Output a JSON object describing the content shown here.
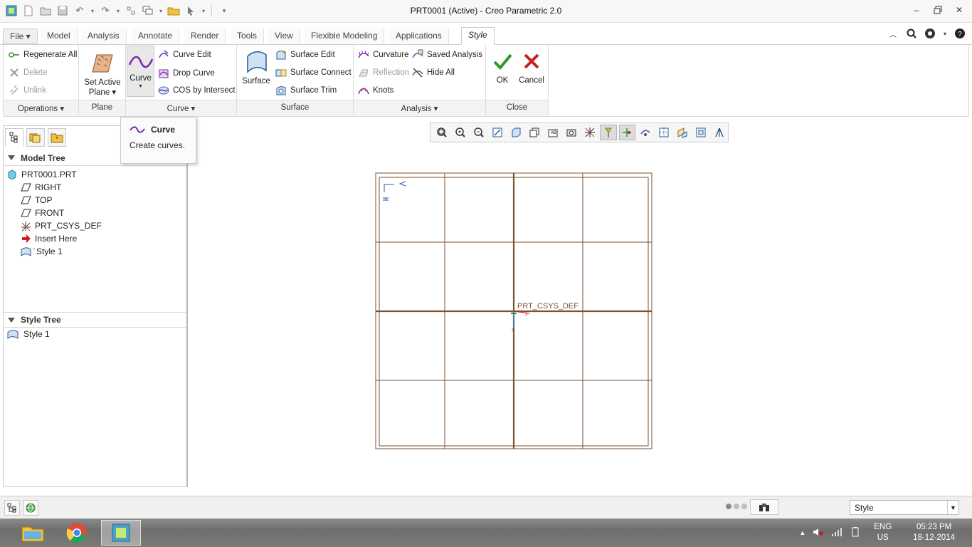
{
  "window": {
    "title": "PRT0001 (Active) - Creo Parametric 2.0"
  },
  "ribbon_tabs": [
    {
      "label": "File"
    },
    {
      "label": "Model"
    },
    {
      "label": "Analysis"
    },
    {
      "label": "Annotate"
    },
    {
      "label": "Render"
    },
    {
      "label": "Tools"
    },
    {
      "label": "View"
    },
    {
      "label": "Flexible Modeling"
    },
    {
      "label": "Applications"
    },
    {
      "label": "Style"
    }
  ],
  "operations": {
    "regenerate": "Regenerate All",
    "delete": "Delete",
    "unlink": "Unlink",
    "label": "Operations"
  },
  "plane": {
    "set_active_line1": "Set Active",
    "set_active_line2": "Plane",
    "label": "Plane"
  },
  "curve": {
    "curve_btn": "Curve",
    "curve_edit": "Curve Edit",
    "drop_curve": "Drop Curve",
    "cos_intersect": "COS by Intersect",
    "label": "Curve"
  },
  "surface": {
    "surface_btn": "Surface",
    "surface_edit": "Surface Edit",
    "surface_connect": "Surface Connect",
    "surface_trim": "Surface Trim",
    "label": "Surface"
  },
  "analysis": {
    "curvature": "Curvature",
    "reflection": "Reflection",
    "knots": "Knots",
    "saved_analysis": "Saved Analysis",
    "hide_all": "Hide All",
    "label": "Analysis"
  },
  "close": {
    "ok": "OK",
    "cancel": "Cancel",
    "label": "Close"
  },
  "tooltip": {
    "title": "Curve",
    "description": "Create curves."
  },
  "model_tree": {
    "header": "Model Tree",
    "root": "PRT0001.PRT",
    "items": [
      "RIGHT",
      "TOP",
      "FRONT",
      "PRT_CSYS_DEF",
      "Insert Here",
      "Style 1"
    ]
  },
  "style_tree": {
    "header": "Style Tree",
    "items": [
      "Style 1"
    ]
  },
  "canvas": {
    "csys_label": "PRT_CSYS_DEF",
    "grid_color": "#7a5230"
  },
  "statusbar": {
    "filter_value": "Style"
  },
  "taskbar": {
    "lang1": "ENG",
    "lang2": "US",
    "time": "05:23 PM",
    "date": "18-12-2014"
  }
}
